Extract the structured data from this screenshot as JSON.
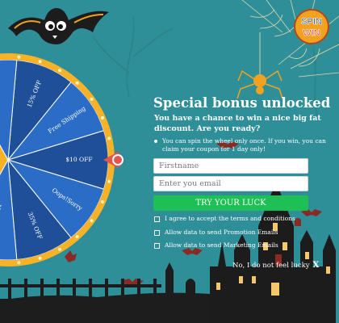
{
  "brand": {
    "logo_line1": "SPIN",
    "logo_line2": "WIN"
  },
  "wheel": {
    "segments": [
      "Not Lucky Today",
      "Oops!Sorry",
      "15% OFF",
      "Free Shipping",
      "$10 OFF",
      "Oops!Sorry",
      "35% OFF"
    ]
  },
  "form": {
    "title": "Special bonus unlocked",
    "subtitle": "You have a chance to win a nice big fat discount. Are you ready?",
    "notice": "You can spin the wheel only once. If you win, you can claim your coupon for 1 day only!",
    "firstname_placeholder": "Firstname",
    "email_placeholder": "Enter you email",
    "cta_label": "TRY YOUR LUCK",
    "checkbox_terms": "I agree to accept the terms and conditions",
    "checkbox_promo": "Allow data to send Promotion Emails",
    "checkbox_marketing": "Allow data to send Marketing Emails",
    "decline_label": "No, I do not feel lucky",
    "decline_icon": "X"
  },
  "colors": {
    "background": "#2f8f98",
    "cta": "#1ec055",
    "wheel_blue_dark": "#1f4f98",
    "wheel_blue_light": "#2a6cc6",
    "wheel_rim": "#f7b228",
    "pointer": "#e4544e"
  }
}
